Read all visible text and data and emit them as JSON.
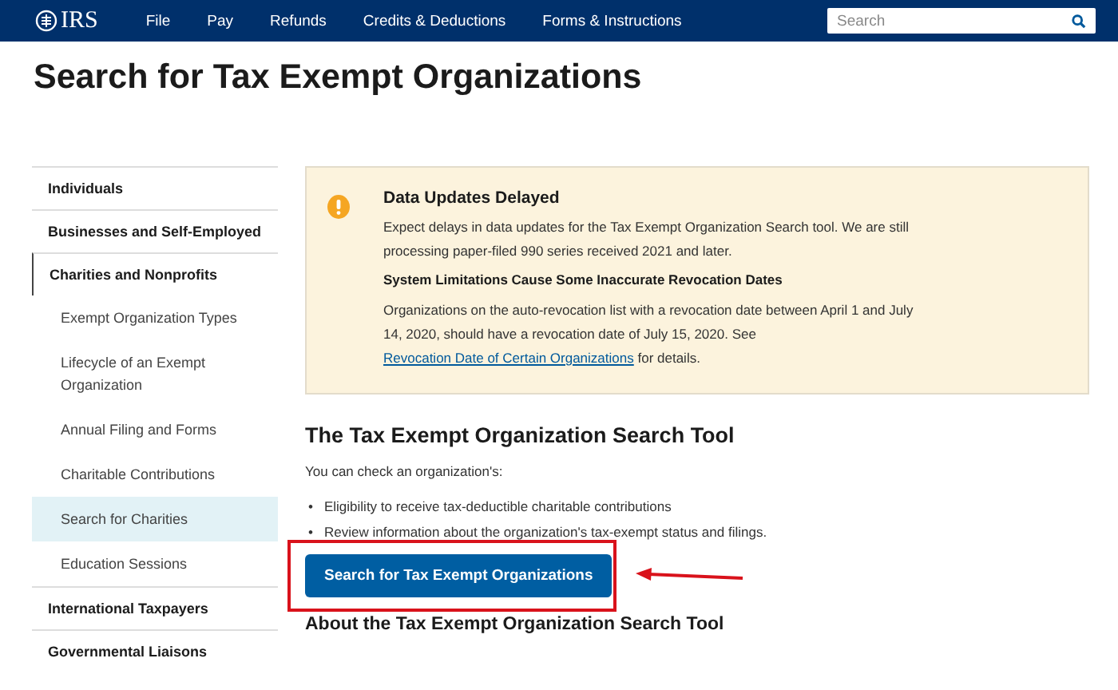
{
  "header": {
    "logo": "IRS",
    "nav": [
      "File",
      "Pay",
      "Refunds",
      "Credits & Deductions",
      "Forms & Instructions"
    ],
    "search": {
      "placeholder": "Search"
    }
  },
  "page_title": "Search for Tax Exempt Organizations",
  "sidebar": {
    "items": [
      {
        "label": "Individuals",
        "expanded": false
      },
      {
        "label": "Businesses and Self-Employed",
        "expanded": false
      },
      {
        "label": "Charities and Nonprofits",
        "expanded": true,
        "children": [
          {
            "label": "Exempt Organization Types",
            "selected": false
          },
          {
            "label": "Lifecycle of an Exempt Organization",
            "selected": false
          },
          {
            "label": "Annual Filing and Forms",
            "selected": false
          },
          {
            "label": "Charitable Contributions",
            "selected": false
          },
          {
            "label": "Search for Charities",
            "selected": true
          },
          {
            "label": "Education Sessions",
            "selected": false
          }
        ]
      },
      {
        "label": "International Taxpayers",
        "expanded": false
      },
      {
        "label": "Governmental Liaisons",
        "expanded": false
      }
    ]
  },
  "alert": {
    "title": "Data Updates Delayed",
    "text": "Expect delays in data updates for the Tax Exempt Organization Search tool. We are still processing paper-filed 990 series received 2021 and later.",
    "subtitle": "System Limitations Cause Some Inaccurate Revocation Dates",
    "text2_before": "Organizations on the auto-revocation list with a revocation date between April 1 and July 14, 2020, should have a revocation date of July 15, 2020. See ",
    "link": "Revocation Date of Certain Organizations",
    "text2_after": " for details."
  },
  "tool_section": {
    "heading": "The Tax Exempt Organization Search Tool",
    "intro": "You can check an organization's:",
    "bullets": [
      {
        "marker": "•",
        "text": "Eligibility to receive tax-deductible charitable contributions"
      },
      {
        "marker": "•",
        "text": "Review information about the organization's tax-exempt status and filings."
      }
    ],
    "button": "Search for Tax Exempt Organizations"
  },
  "about_heading": "About the Tax Exempt Organization Search Tool",
  "annotations": {
    "highlight_box": true,
    "arrow": true
  }
}
